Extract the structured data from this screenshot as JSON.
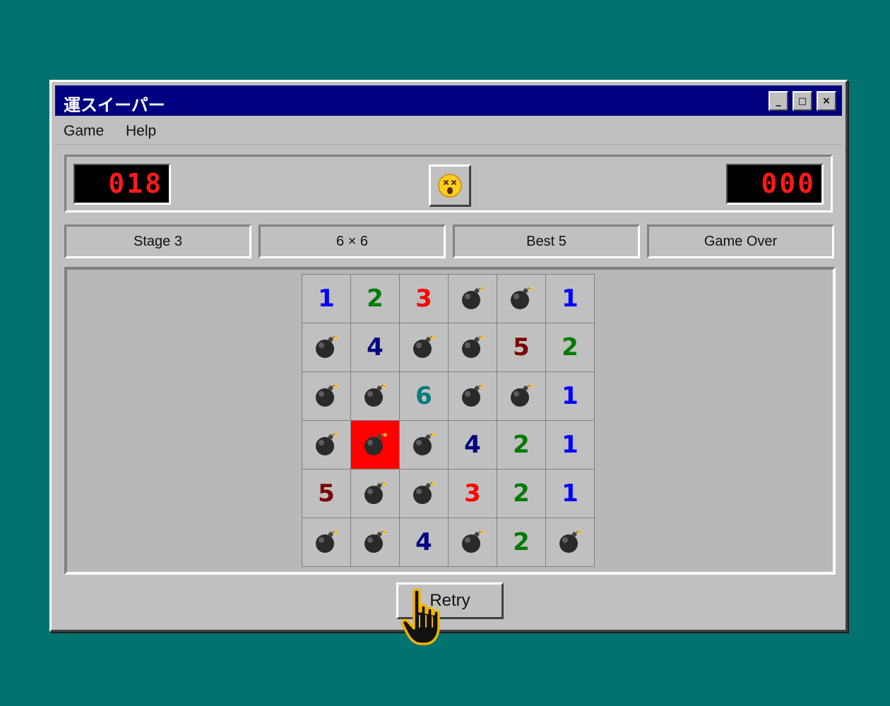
{
  "window": {
    "title": "運スイーパー",
    "minimize_label": "_",
    "maximize_label": "□",
    "close_label": "×"
  },
  "menu": [
    "Game",
    "Help"
  ],
  "status": {
    "mines_left": "018",
    "timer": "000",
    "face_icon": "dizzy-face-icon"
  },
  "info": [
    "Stage 3",
    "6 × 6",
    "Best 5",
    "Game Over"
  ],
  "board": {
    "rows": [
      [
        "1",
        "2",
        "3",
        "mine",
        "mine",
        "1"
      ],
      [
        "mine",
        "4",
        "mine",
        "mine",
        "5",
        "2"
      ],
      [
        "mine",
        "mine",
        "6",
        "mine",
        "mine",
        "1"
      ],
      [
        "mine",
        "mine-hit",
        "mine",
        "4",
        "2",
        "1"
      ],
      [
        "5",
        "mine",
        "mine",
        "3",
        "2",
        "1"
      ],
      [
        "mine",
        "mine",
        "4",
        "mine",
        "2",
        "mine"
      ]
    ],
    "number_colors": {
      "1": "#0000ff",
      "2": "#007b00",
      "3": "#ff0000",
      "4": "#000080",
      "5": "#7b0000",
      "6": "#007b7b",
      "7": "#000000",
      "8": "#808080"
    },
    "hit_color": "#ff0000"
  },
  "retry_label": "Retry",
  "colors": {
    "desktop": "#007370",
    "titlebar": "#000080",
    "face": "#c0c0c0",
    "counter_text": "#ff1a1a"
  }
}
